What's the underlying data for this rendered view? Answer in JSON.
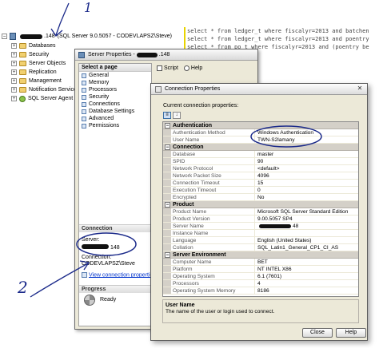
{
  "explorer": {
    "server": {
      "name_suffix": ".148",
      "description": "(SQL Server 9.0.5057 - CODEVLAPSZ\\Steve)"
    },
    "nodes": [
      {
        "label": "Databases"
      },
      {
        "label": "Security"
      },
      {
        "label": "Server Objects"
      },
      {
        "label": "Replication"
      },
      {
        "label": "Management"
      },
      {
        "label": "Notification Services"
      },
      {
        "label": "SQL Server Agent"
      }
    ]
  },
  "editor": {
    "lines": [
      "select * from ledger_t where fiscalyr=2013 and batchen",
      "select * from ledger_t where fiscalyr=2013 and poentry",
      "select * from po_t where fiscalyr=2013 and (poentry be"
    ]
  },
  "server_props": {
    "title": "Server Properties - ",
    "title_suffix": ".148",
    "select_page": "Select a page",
    "pages": [
      "General",
      "Memory",
      "Processors",
      "Security",
      "Connections",
      "Database Settings",
      "Advanced",
      "Permissions"
    ],
    "toolbar": {
      "script": "Script",
      "help": "Help"
    },
    "connection_head": "Connection",
    "server_label": "Server:",
    "server_suffix": "148",
    "connection_label": "Connection:",
    "connection_value": "CODEVLAPSZ\\Steve",
    "view_link": "View connection properties",
    "progress_head": "Progress",
    "progress_status": "Ready"
  },
  "conn_props": {
    "title": "Connection Properties",
    "current_label": "Current connection properties:",
    "categories": [
      {
        "name": "Authentication",
        "rows": [
          {
            "name": "Authentication Method",
            "value": "Windows Authentication"
          },
          {
            "name": "User Name",
            "value": "TWN-S2lamany"
          }
        ]
      },
      {
        "name": "Connection",
        "rows": [
          {
            "name": "Database",
            "value": "master"
          },
          {
            "name": "SPID",
            "value": "90"
          },
          {
            "name": "Network Protocol",
            "value": "<default>"
          },
          {
            "name": "Network Packet Size",
            "value": "4096"
          },
          {
            "name": "Connection Timeout",
            "value": "15"
          },
          {
            "name": "Execution Timeout",
            "value": "0"
          },
          {
            "name": "Encrypted",
            "value": "No"
          }
        ]
      },
      {
        "name": "Product",
        "rows": [
          {
            "name": "Product Name",
            "value": "Microsoft SQL Server Standard Edition"
          },
          {
            "name": "Product Version",
            "value": "9.00.5057 SP4"
          },
          {
            "name": "Server Name",
            "value": "48",
            "redacted": true
          },
          {
            "name": "Instance Name",
            "value": ""
          },
          {
            "name": "Language",
            "value": "English (United States)"
          },
          {
            "name": "Collation",
            "value": "SQL_Latin1_General_CP1_CI_AS"
          }
        ]
      },
      {
        "name": "Server Environment",
        "rows": [
          {
            "name": "Computer Name",
            "value": "BET"
          },
          {
            "name": "Platform",
            "value": "NT INTEL X86"
          },
          {
            "name": "Operating System",
            "value": "6.1 (7601)"
          },
          {
            "name": "Processors",
            "value": "4"
          },
          {
            "name": "Operating System Memory",
            "value": "8186"
          }
        ]
      }
    ],
    "description_title": "User Name",
    "description_text": "The name of the user or login used to connect.",
    "close_label": "Close",
    "help_label": "Help"
  },
  "annotations": {
    "one": "1",
    "two": "2"
  },
  "colors": {
    "annotation_ink": "#1b2a8a",
    "dialog_face": "#ece9d8",
    "category_bg": "#d4d0c8"
  }
}
